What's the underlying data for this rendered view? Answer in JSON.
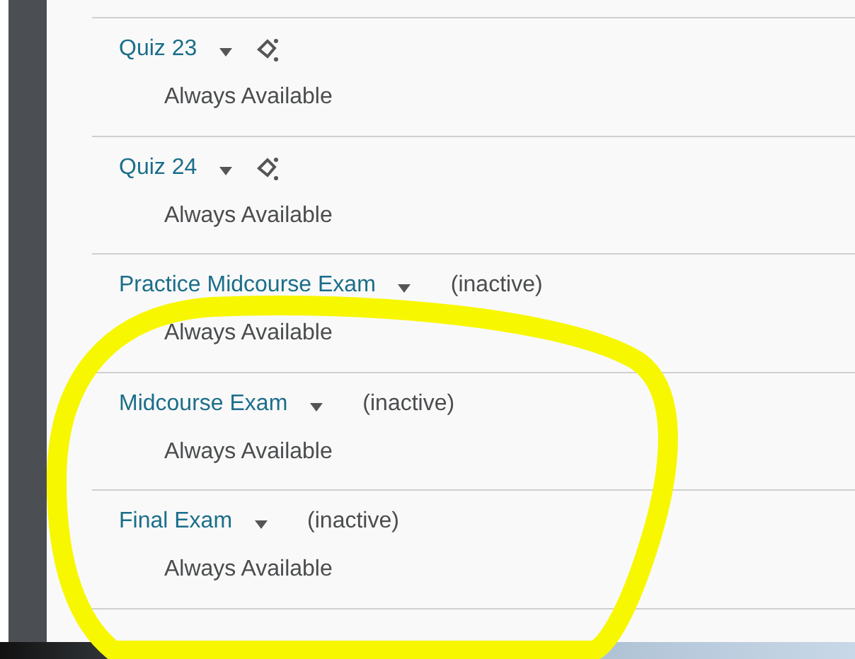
{
  "items": [
    {
      "kind": "quiz",
      "title": "Quiz 23",
      "availability": "Always Available"
    },
    {
      "kind": "quiz",
      "title": "Quiz 24",
      "availability": "Always Available"
    },
    {
      "kind": "status",
      "title": "Practice Midcourse Exam",
      "status": "(inactive)",
      "availability": "Always Available"
    },
    {
      "kind": "status",
      "title": "Midcourse Exam",
      "status": "(inactive)",
      "availability": "Always Available"
    },
    {
      "kind": "status",
      "title": "Final Exam",
      "status": "(inactive)",
      "availability": "Always Available"
    }
  ]
}
